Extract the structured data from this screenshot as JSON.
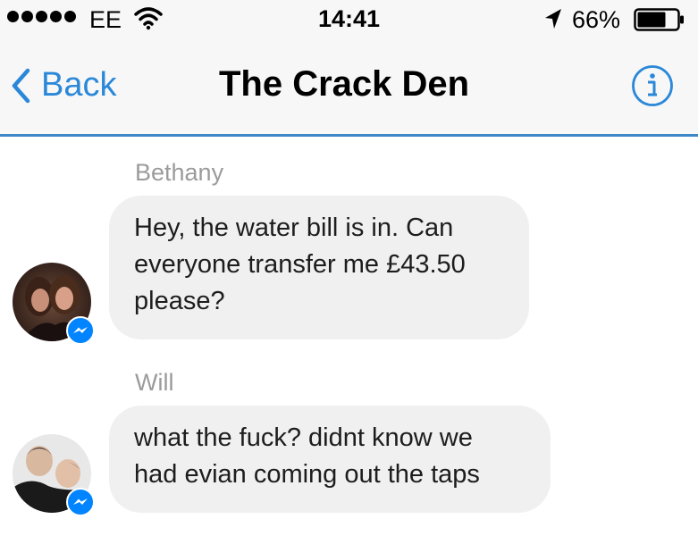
{
  "status_bar": {
    "carrier": "EE",
    "time": "14:41",
    "battery": "66%",
    "icons": [
      "signal-dots-icon",
      "wifi-icon",
      "location-arrow-icon",
      "battery-icon"
    ]
  },
  "nav": {
    "back_label": "Back",
    "title": "The Crack Den",
    "info_icon": "info-icon"
  },
  "messages": [
    {
      "sender": "Bethany",
      "lines": [
        "Hey, the water bill is in. Can",
        "everyone transfer me £43.50",
        "please?"
      ]
    },
    {
      "sender": "Will",
      "lines": [
        "what the fuck? didnt know we",
        "had evian coming out the taps"
      ]
    }
  ],
  "colors": {
    "accent": "#2b88d8",
    "nav_divider": "#3d86c8",
    "bubble_bg": "#f1f0f0",
    "sender_gray": "#9b9b9b",
    "messenger_badge": "#0084ff"
  }
}
